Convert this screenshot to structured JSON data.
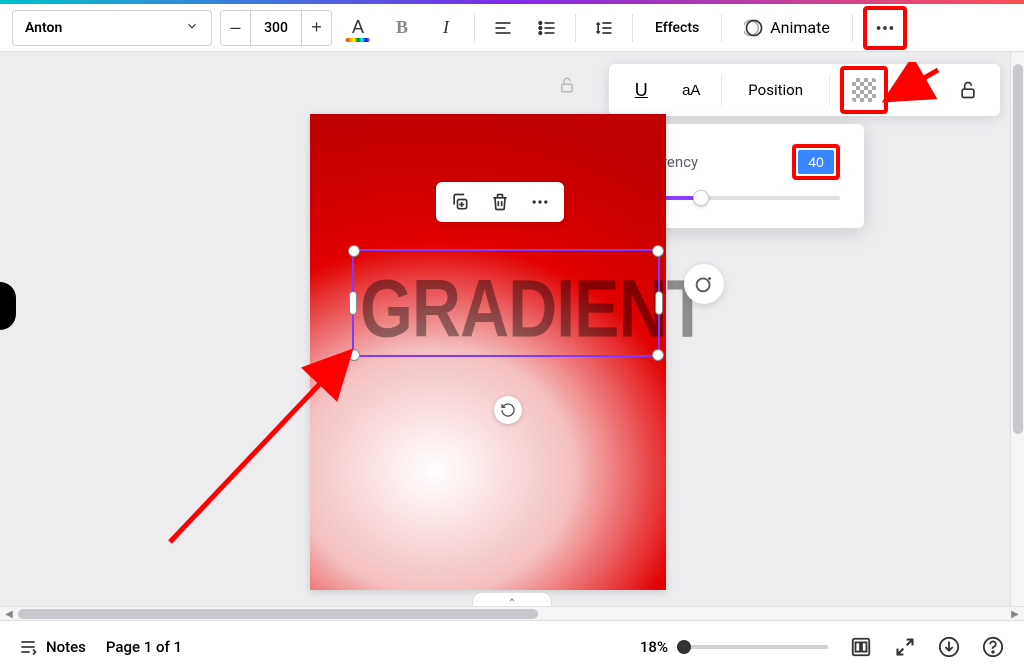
{
  "toolbar": {
    "font_name": "Anton",
    "font_size": "300",
    "effects_label": "Effects",
    "animate_label": "Animate"
  },
  "secondary": {
    "position_label": "Position"
  },
  "transparency": {
    "label": "Transparency",
    "value": "40"
  },
  "canvas": {
    "text": "GRADIENT"
  },
  "footer": {
    "notes_label": "Notes",
    "page_label": "Page 1 of 1",
    "zoom_label": "18%"
  },
  "colors": {
    "accent": "#8b3dff",
    "highlight_red": "#ff0000"
  }
}
